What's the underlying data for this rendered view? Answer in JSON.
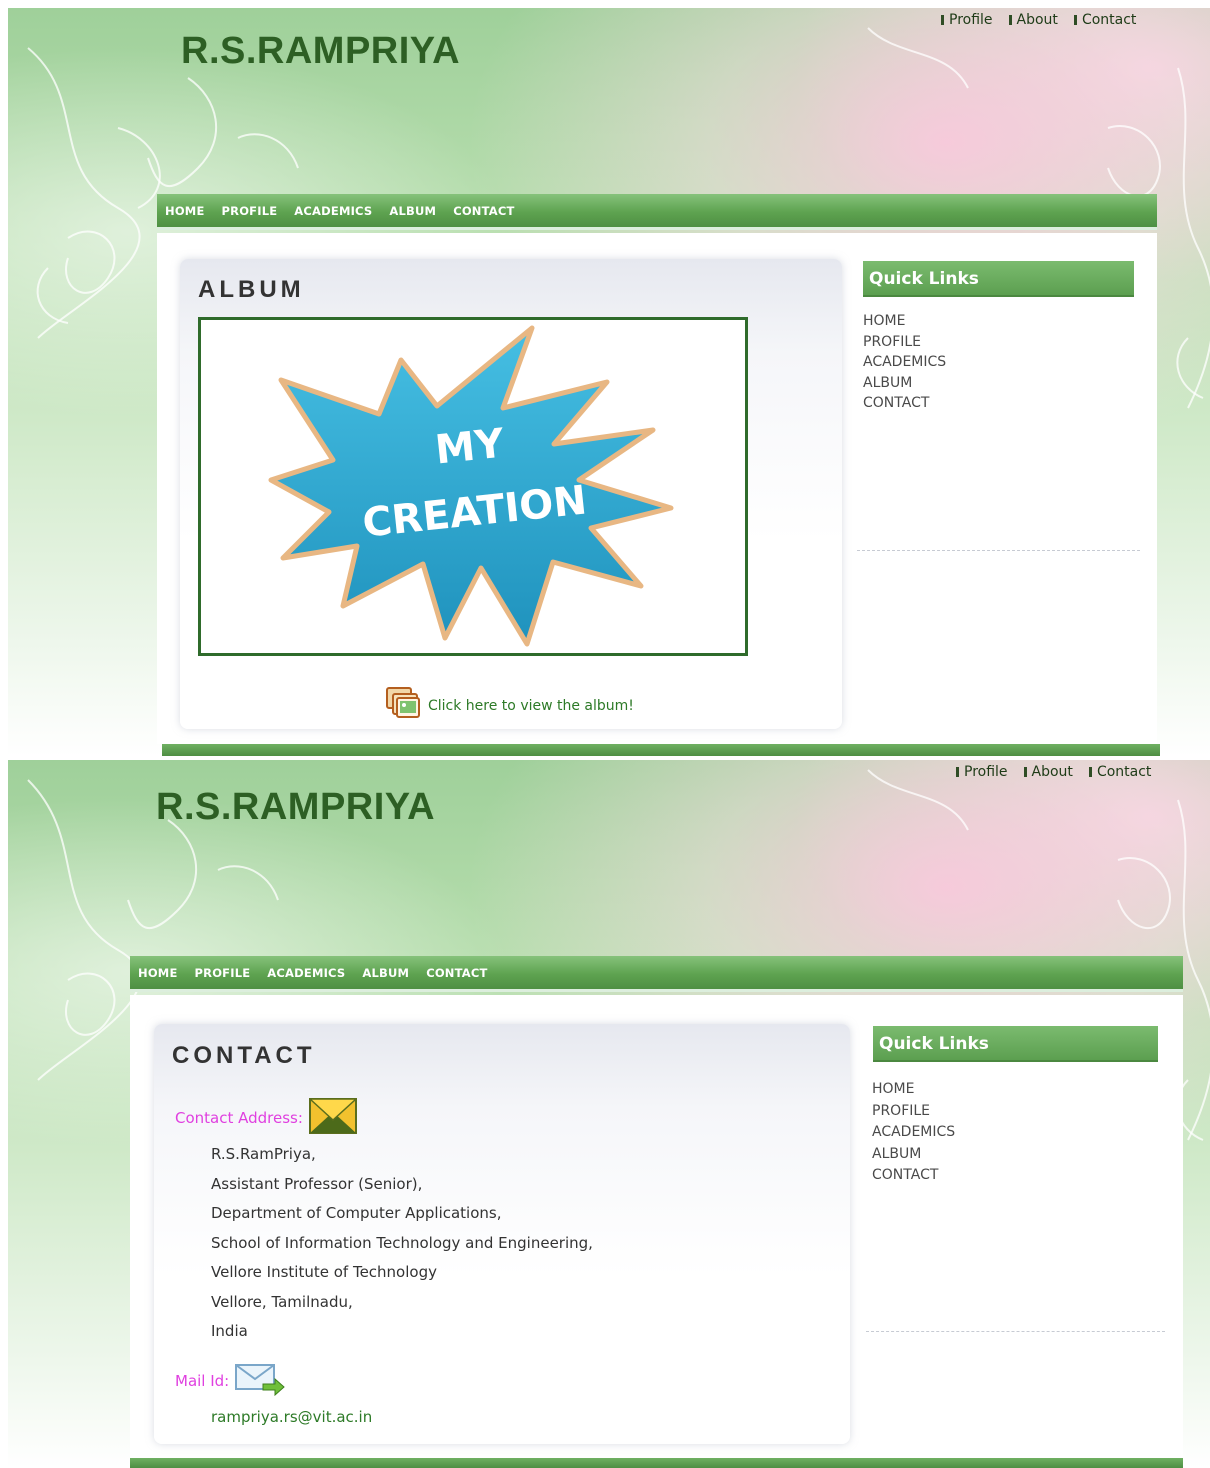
{
  "site": {
    "title": "R.S.RAMPRIYA"
  },
  "toplinks": [
    "Profile",
    "About",
    "Contact"
  ],
  "nav": [
    "HOME",
    "PROFILE",
    "ACADEMICS",
    "ALBUM",
    "CONTACT"
  ],
  "quick_links": {
    "title": "Quick Links",
    "items": [
      "HOME",
      "PROFILE",
      "ACADEMICS",
      "ALBUM",
      "CONTACT"
    ]
  },
  "album": {
    "heading": "ALBUM",
    "image_text": [
      "MY",
      "CREATION"
    ],
    "link_text": "Click here to view the album!"
  },
  "contact": {
    "heading": "CONTACT",
    "address_label": "Contact Address:",
    "address_lines": [
      "R.S.RamPriya,",
      "Assistant Professor (Senior),",
      "Department of Computer Applications,",
      "School of Information Technology and Engineering,",
      "Vellore Institute of Technology",
      "Vellore, Tamilnadu,",
      "India"
    ],
    "mail_label": "Mail Id:",
    "email": "rampriya.rs@vit.ac.in"
  },
  "colors": {
    "nav_green": "#5ea350",
    "title_green": "#2d5f24",
    "label_magenta": "#e040e0",
    "link_green": "#2d7a27",
    "star_blue": "#2aa8cf"
  },
  "icons": [
    "album-icon",
    "envelope-icon",
    "mail-send-icon"
  ]
}
